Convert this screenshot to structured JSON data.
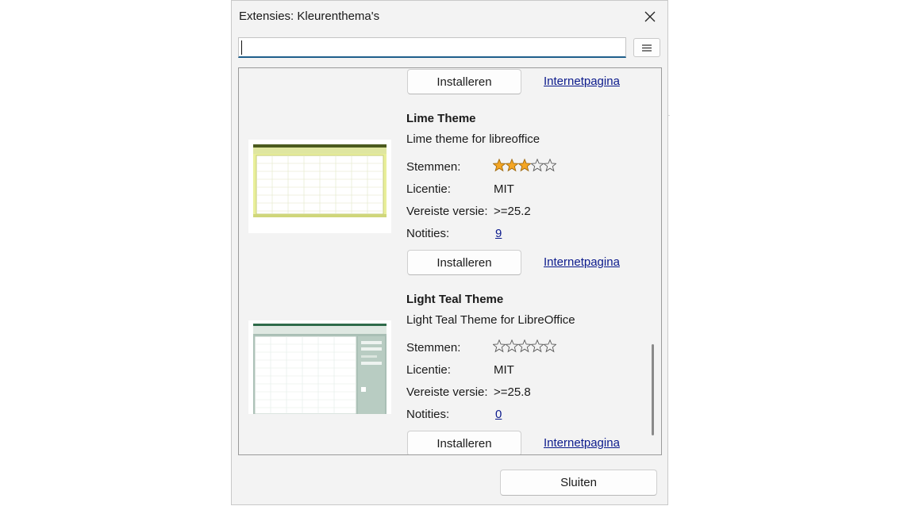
{
  "dialog": {
    "title": "Extensies: Kleurenthema's",
    "search": {
      "value": "",
      "placeholder": ""
    },
    "close_icon": "close-icon",
    "menu_icon": "hamburger-menu-icon"
  },
  "extensions": [
    {
      "name": "",
      "install_label": "Installeren",
      "homepage_label": "Internetpagina"
    },
    {
      "name": "Lime Theme",
      "description": "Lime theme for libreoffice",
      "votes_label": "Stemmen:",
      "rating": 3,
      "license_label": "Licentie:",
      "license": "MIT",
      "version_label": "Vereiste versie:",
      "version": ">=25.2",
      "notes_label": "Notities:",
      "notes": "9",
      "install_label": "Installeren",
      "homepage_label": "Internetpagina",
      "thumbnail": "spreadsheet-preview-lime"
    },
    {
      "name": "Light Teal Theme",
      "description": "Light Teal Theme for LibreOffice",
      "votes_label": "Stemmen:",
      "rating": 0,
      "license_label": "Licentie:",
      "license": "MIT",
      "version_label": "Vereiste versie:",
      "version": ">=25.8",
      "notes_label": "Notities:",
      "notes": "0",
      "install_label": "Installeren",
      "homepage_label": "Internetpagina",
      "thumbnail": "spreadsheet-preview-teal"
    }
  ],
  "footer": {
    "close_label": "Sluiten"
  },
  "colors": {
    "star_filled": "#f5a623",
    "star_empty": "#bdbdbd",
    "link": "#0b1a8c",
    "input_focus": "#1f5f8b"
  }
}
